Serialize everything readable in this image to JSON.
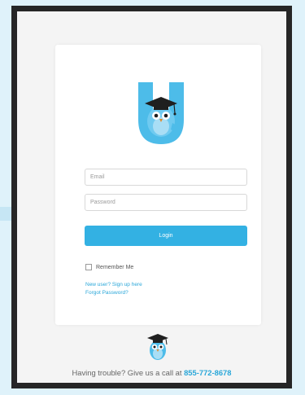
{
  "form": {
    "email_placeholder": "Email",
    "password_placeholder": "Password",
    "login_label": "Login",
    "remember_label": "Remember Me",
    "signup_link": "New user? Sign up here",
    "forgot_link": "Forgot Password?"
  },
  "footer": {
    "text": "Having trouble? Give us a call at",
    "phone": "855-772-8678"
  },
  "icons": {
    "logo": "owl-graduate-u-logo-icon",
    "mascot": "owl-graduate-mascot-icon"
  },
  "colors": {
    "accent": "#33b1e3",
    "link": "#2aa7d9",
    "page_background": "#dff2fa"
  }
}
